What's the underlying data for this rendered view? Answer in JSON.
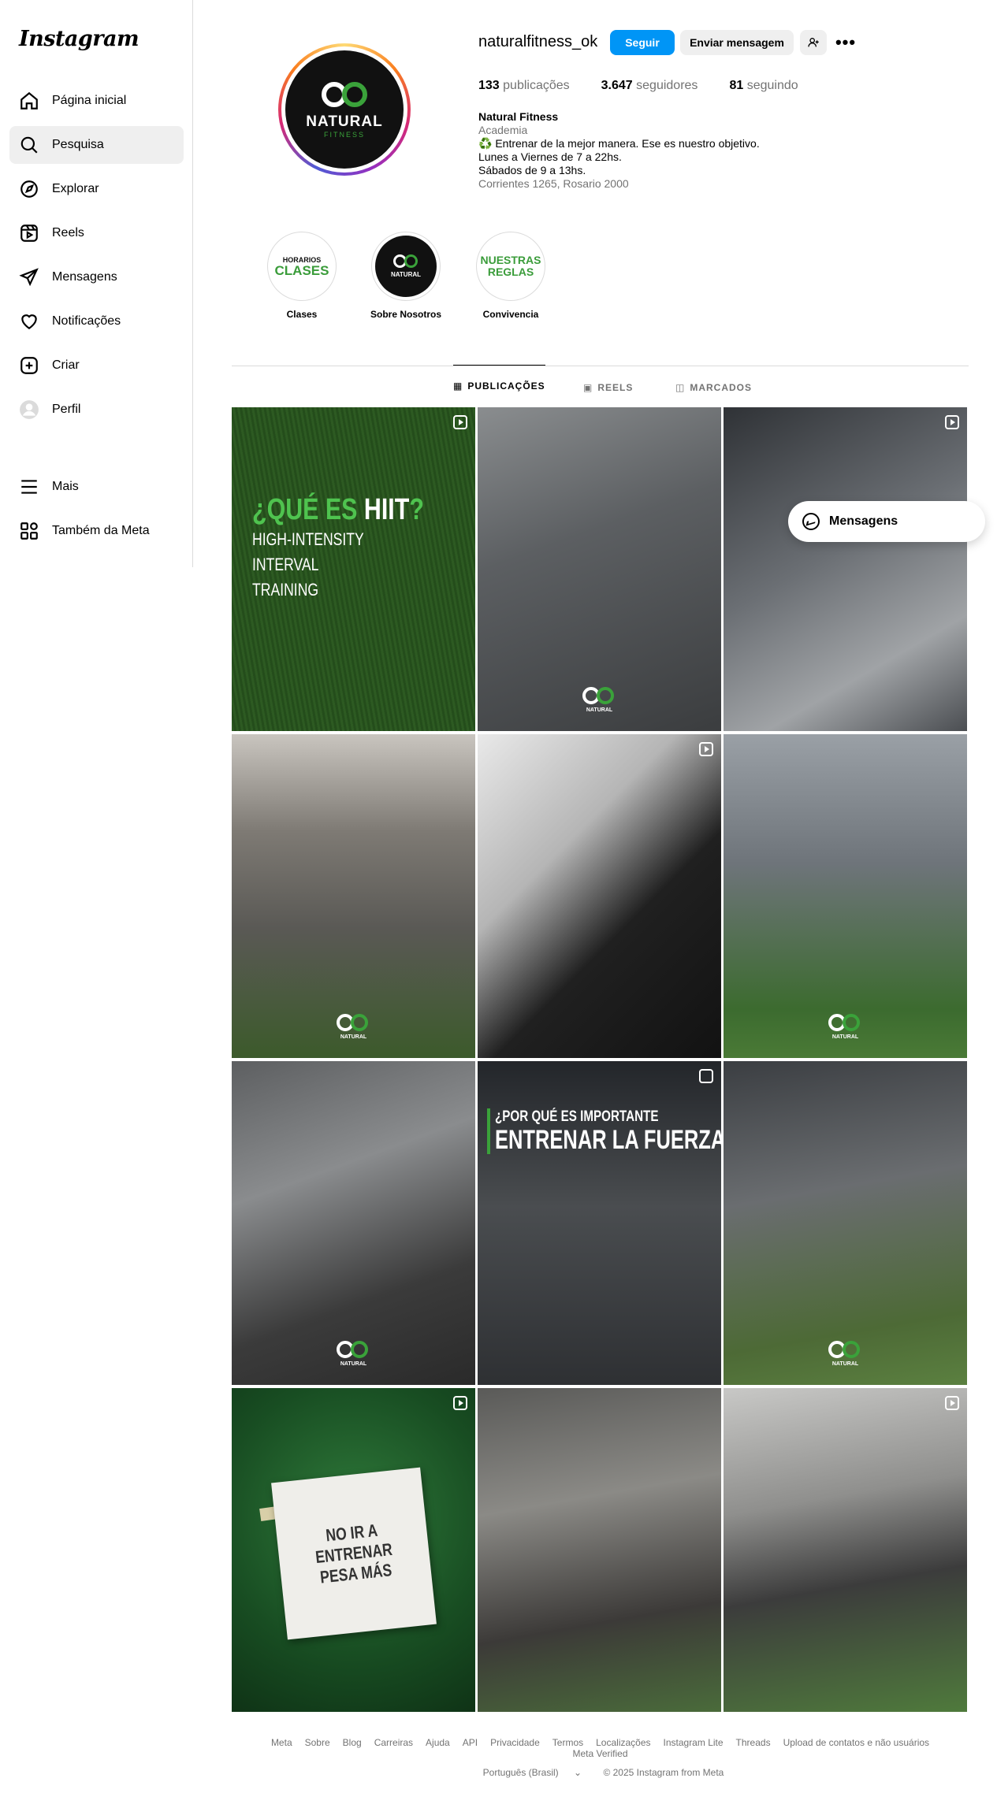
{
  "app": {
    "logo": "Instagram"
  },
  "sidebar": {
    "items": [
      {
        "label": "Página inicial",
        "icon": "home-icon"
      },
      {
        "label": "Pesquisa",
        "icon": "search-icon",
        "active": true
      },
      {
        "label": "Explorar",
        "icon": "compass-icon"
      },
      {
        "label": "Reels",
        "icon": "reels-icon"
      },
      {
        "label": "Mensagens",
        "icon": "send-icon"
      },
      {
        "label": "Notificações",
        "icon": "heart-icon"
      },
      {
        "label": "Criar",
        "icon": "plus-square-icon"
      },
      {
        "label": "Perfil",
        "icon": "avatar-icon"
      }
    ],
    "bottom": [
      {
        "label": "Mais",
        "icon": "menu-icon"
      },
      {
        "label": "Também da Meta",
        "icon": "apps-icon"
      }
    ]
  },
  "profile": {
    "username": "naturalfitness_ok",
    "follow_label": "Seguir",
    "message_label": "Enviar mensagem",
    "avatar_title": "NATURAL",
    "avatar_sub": "FITNESS",
    "stats": {
      "posts_count": "133",
      "posts_label": "publicações",
      "followers_count": "3.647",
      "followers_label": "seguidores",
      "following_count": "81",
      "following_label": "seguindo"
    },
    "bio": {
      "name": "Natural Fitness",
      "category": "Academia",
      "line1": "♻️ Entrenar de la mejor manera. Ese es nuestro objetivo.",
      "line2": "Lunes a Viernes de 7 a 22hs.",
      "line3": "Sábados de 9 a 13hs.",
      "address": "Corrientes 1265, Rosario 2000"
    }
  },
  "highlights": [
    {
      "label": "Clases",
      "t1": "HORARIOS",
      "t2": "CLASES"
    },
    {
      "label": "Sobre Nosotros",
      "t1": "NATURAL",
      "t2": ""
    },
    {
      "label": "Convivencia",
      "t1": "NUESTRAS",
      "t2": "REGLAS"
    }
  ],
  "tabs": [
    {
      "label": "PUBLICAÇÕES",
      "active": true
    },
    {
      "label": "REELS"
    },
    {
      "label": "MARCADOS"
    }
  ],
  "posts": {
    "hiit": {
      "q_pre": "¿QUÉ ES ",
      "q_main": "HIIT",
      "q_post": "?",
      "l1": "HIGH-INTENSITY",
      "l2": "INTERVAL",
      "l3": "TRAINING"
    },
    "fuerza": {
      "l1": "¿POR QUÉ ES IMPORTANTE",
      "l2": "ENTRENAR LA FUERZA?"
    },
    "note": {
      "l1": "NO IR A ENTRENAR",
      "l2": "PESA MÁS"
    },
    "watermark": "NATURAL"
  },
  "floating_messages": {
    "label": "Mensagens"
  },
  "footer": {
    "links": [
      "Meta",
      "Sobre",
      "Blog",
      "Carreiras",
      "Ajuda",
      "API",
      "Privacidade",
      "Termos",
      "Localizações",
      "Instagram Lite",
      "Threads",
      "Upload de contatos e não usuários",
      "Meta Verified"
    ],
    "language": "Português (Brasil)",
    "copyright": "© 2025 Instagram from Meta"
  }
}
